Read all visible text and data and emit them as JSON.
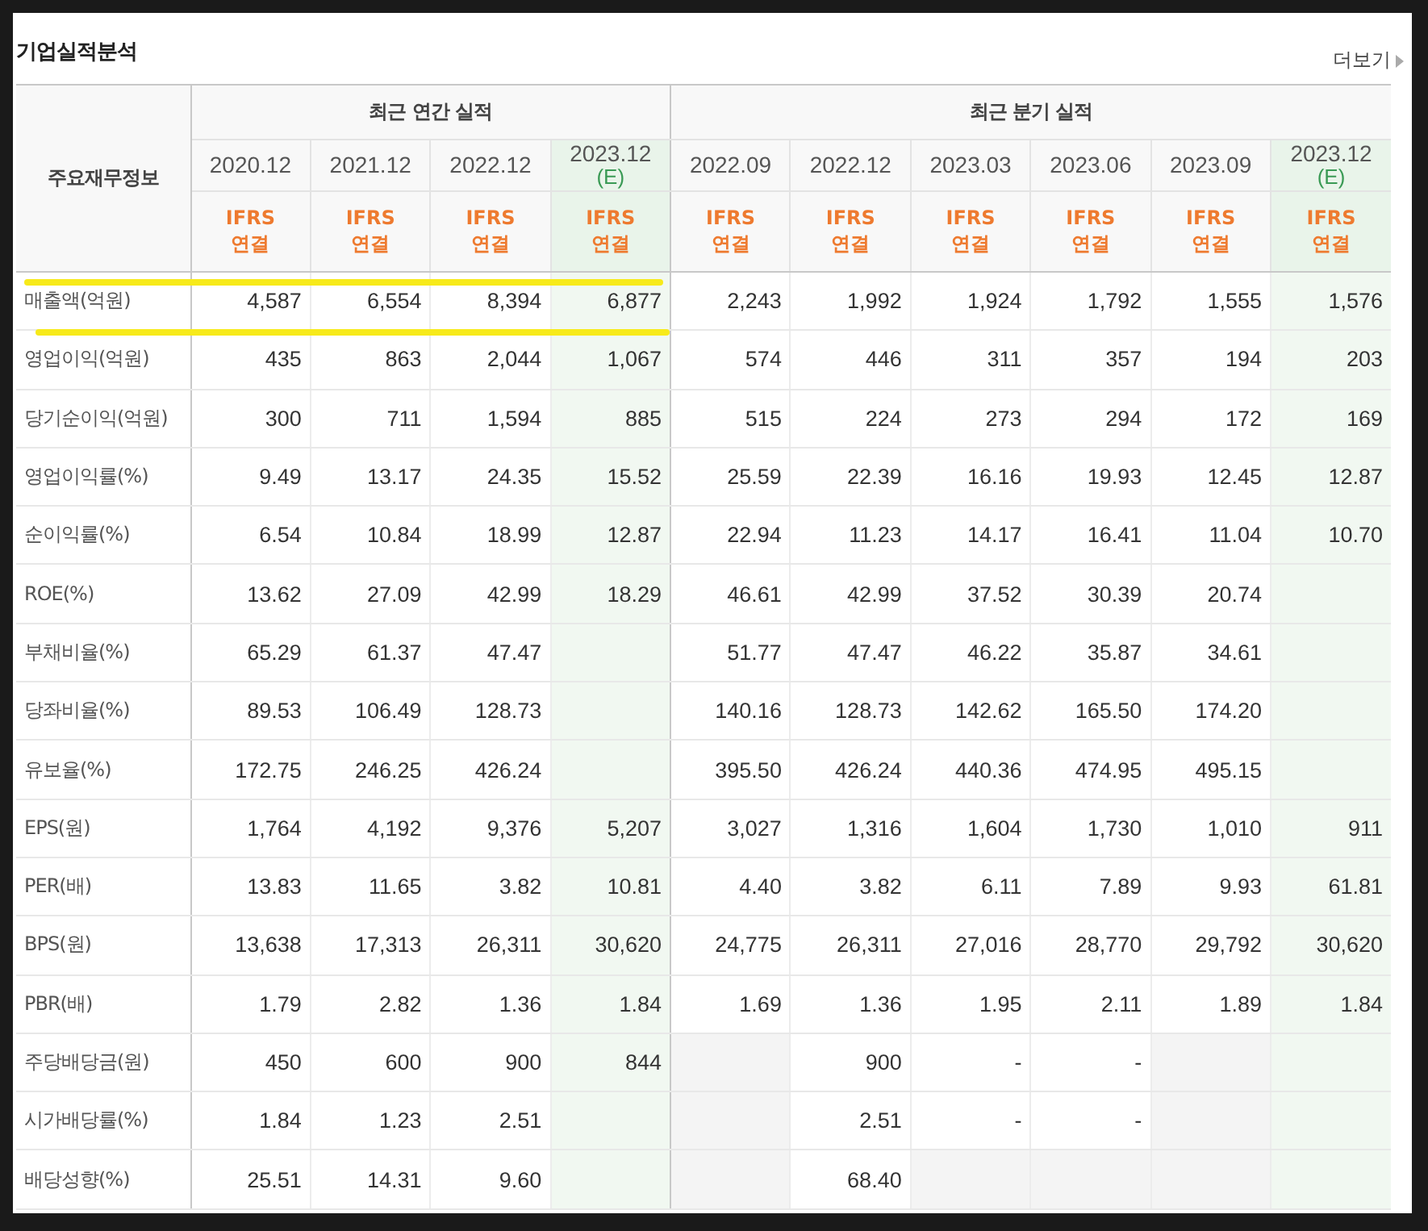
{
  "title": "기업실적분석",
  "more_link": "더보기",
  "table": {
    "corner_header": "주요재무정보",
    "groups": [
      {
        "label": "최근 연간 실적",
        "columns": [
          {
            "period": "2020.12",
            "estimate": false,
            "standard": "IFRS",
            "basis": "연결"
          },
          {
            "period": "2021.12",
            "estimate": false,
            "standard": "IFRS",
            "basis": "연결"
          },
          {
            "period": "2022.12",
            "estimate": false,
            "standard": "IFRS",
            "basis": "연결"
          },
          {
            "period": "2023.12",
            "note": "(E)",
            "estimate": true,
            "standard": "IFRS",
            "basis": "연결"
          }
        ]
      },
      {
        "label": "최근 분기 실적",
        "columns": [
          {
            "period": "2022.09",
            "estimate": false,
            "standard": "IFRS",
            "basis": "연결"
          },
          {
            "period": "2022.12",
            "estimate": false,
            "standard": "IFRS",
            "basis": "연결"
          },
          {
            "period": "2023.03",
            "estimate": false,
            "standard": "IFRS",
            "basis": "연결"
          },
          {
            "period": "2023.06",
            "estimate": false,
            "standard": "IFRS",
            "basis": "연결"
          },
          {
            "period": "2023.09",
            "estimate": false,
            "standard": "IFRS",
            "basis": "연결"
          },
          {
            "period": "2023.12",
            "note": "(E)",
            "estimate": true,
            "standard": "IFRS",
            "basis": "연결"
          }
        ]
      }
    ],
    "sections": [
      {
        "rows": [
          {
            "label": "매출액(억원)",
            "cells": [
              "4,587",
              "6,554",
              "8,394",
              "6,877",
              "2,243",
              "1,992",
              "1,924",
              "1,792",
              "1,555",
              "1,576"
            ]
          },
          {
            "label": "영업이익(억원)",
            "cells": [
              "435",
              "863",
              "2,044",
              "1,067",
              "574",
              "446",
              "311",
              "357",
              "194",
              "203"
            ]
          },
          {
            "label": "당기순이익(억원)",
            "cells": [
              "300",
              "711",
              "1,594",
              "885",
              "515",
              "224",
              "273",
              "294",
              "172",
              "169"
            ]
          }
        ]
      },
      {
        "rows": [
          {
            "label": "영업이익률(%)",
            "cells": [
              "9.49",
              "13.17",
              "24.35",
              "15.52",
              "25.59",
              "22.39",
              "16.16",
              "19.93",
              "12.45",
              "12.87"
            ]
          },
          {
            "label": "순이익률(%)",
            "cells": [
              "6.54",
              "10.84",
              "18.99",
              "12.87",
              "22.94",
              "11.23",
              "14.17",
              "16.41",
              "11.04",
              "10.70"
            ]
          },
          {
            "label": "ROE(%)",
            "cells": [
              "13.62",
              "27.09",
              "42.99",
              "18.29",
              "46.61",
              "42.99",
              "37.52",
              "30.39",
              "20.74",
              {
                "kind": "empty"
              }
            ]
          }
        ]
      },
      {
        "rows": [
          {
            "label": "부채비율(%)",
            "cells": [
              "65.29",
              "61.37",
              "47.47",
              {
                "kind": "empty"
              },
              "51.77",
              "47.47",
              "46.22",
              "35.87",
              "34.61",
              {
                "kind": "empty"
              }
            ]
          },
          {
            "label": "당좌비율(%)",
            "cells": [
              "89.53",
              "106.49",
              "128.73",
              {
                "kind": "empty"
              },
              "140.16",
              "128.73",
              "142.62",
              "165.50",
              "174.20",
              {
                "kind": "empty"
              }
            ]
          },
          {
            "label": "유보율(%)",
            "cells": [
              "172.75",
              "246.25",
              "426.24",
              {
                "kind": "empty"
              },
              "395.50",
              "426.24",
              "440.36",
              "474.95",
              "495.15",
              {
                "kind": "empty"
              }
            ]
          }
        ]
      },
      {
        "rows": [
          {
            "label": "EPS(원)",
            "cells": [
              "1,764",
              "4,192",
              "9,376",
              "5,207",
              "3,027",
              "1,316",
              "1,604",
              "1,730",
              "1,010",
              "911"
            ]
          },
          {
            "label": "PER(배)",
            "cells": [
              "13.83",
              "11.65",
              "3.82",
              "10.81",
              "4.40",
              "3.82",
              "6.11",
              "7.89",
              "9.93",
              "61.81"
            ]
          },
          {
            "label": "BPS(원)",
            "cells": [
              "13,638",
              "17,313",
              "26,311",
              "30,620",
              "24,775",
              "26,311",
              "27,016",
              "28,770",
              "29,792",
              "30,620"
            ]
          },
          {
            "label": "PBR(배)",
            "cells": [
              "1.79",
              "2.82",
              "1.36",
              "1.84",
              "1.69",
              "1.36",
              "1.95",
              "2.11",
              "1.89",
              "1.84"
            ]
          }
        ]
      },
      {
        "rows": [
          {
            "label": "주당배당금(원)",
            "cells": [
              "450",
              "600",
              "900",
              "844",
              {
                "kind": "na"
              },
              "900",
              "-",
              "-",
              {
                "kind": "na"
              },
              {
                "kind": "empty"
              }
            ]
          },
          {
            "label": "시가배당률(%)",
            "cells": [
              "1.84",
              "1.23",
              "2.51",
              {
                "kind": "empty"
              },
              {
                "kind": "na"
              },
              "2.51",
              "-",
              "-",
              {
                "kind": "na"
              },
              {
                "kind": "empty"
              }
            ]
          },
          {
            "label": "배당성향(%)",
            "cells": [
              "25.51",
              "14.31",
              "9.60",
              {
                "kind": "empty"
              },
              {
                "kind": "na"
              },
              "68.40",
              {
                "kind": "na"
              },
              {
                "kind": "na"
              },
              {
                "kind": "na"
              },
              {
                "kind": "empty"
              }
            ]
          }
        ]
      }
    ]
  }
}
